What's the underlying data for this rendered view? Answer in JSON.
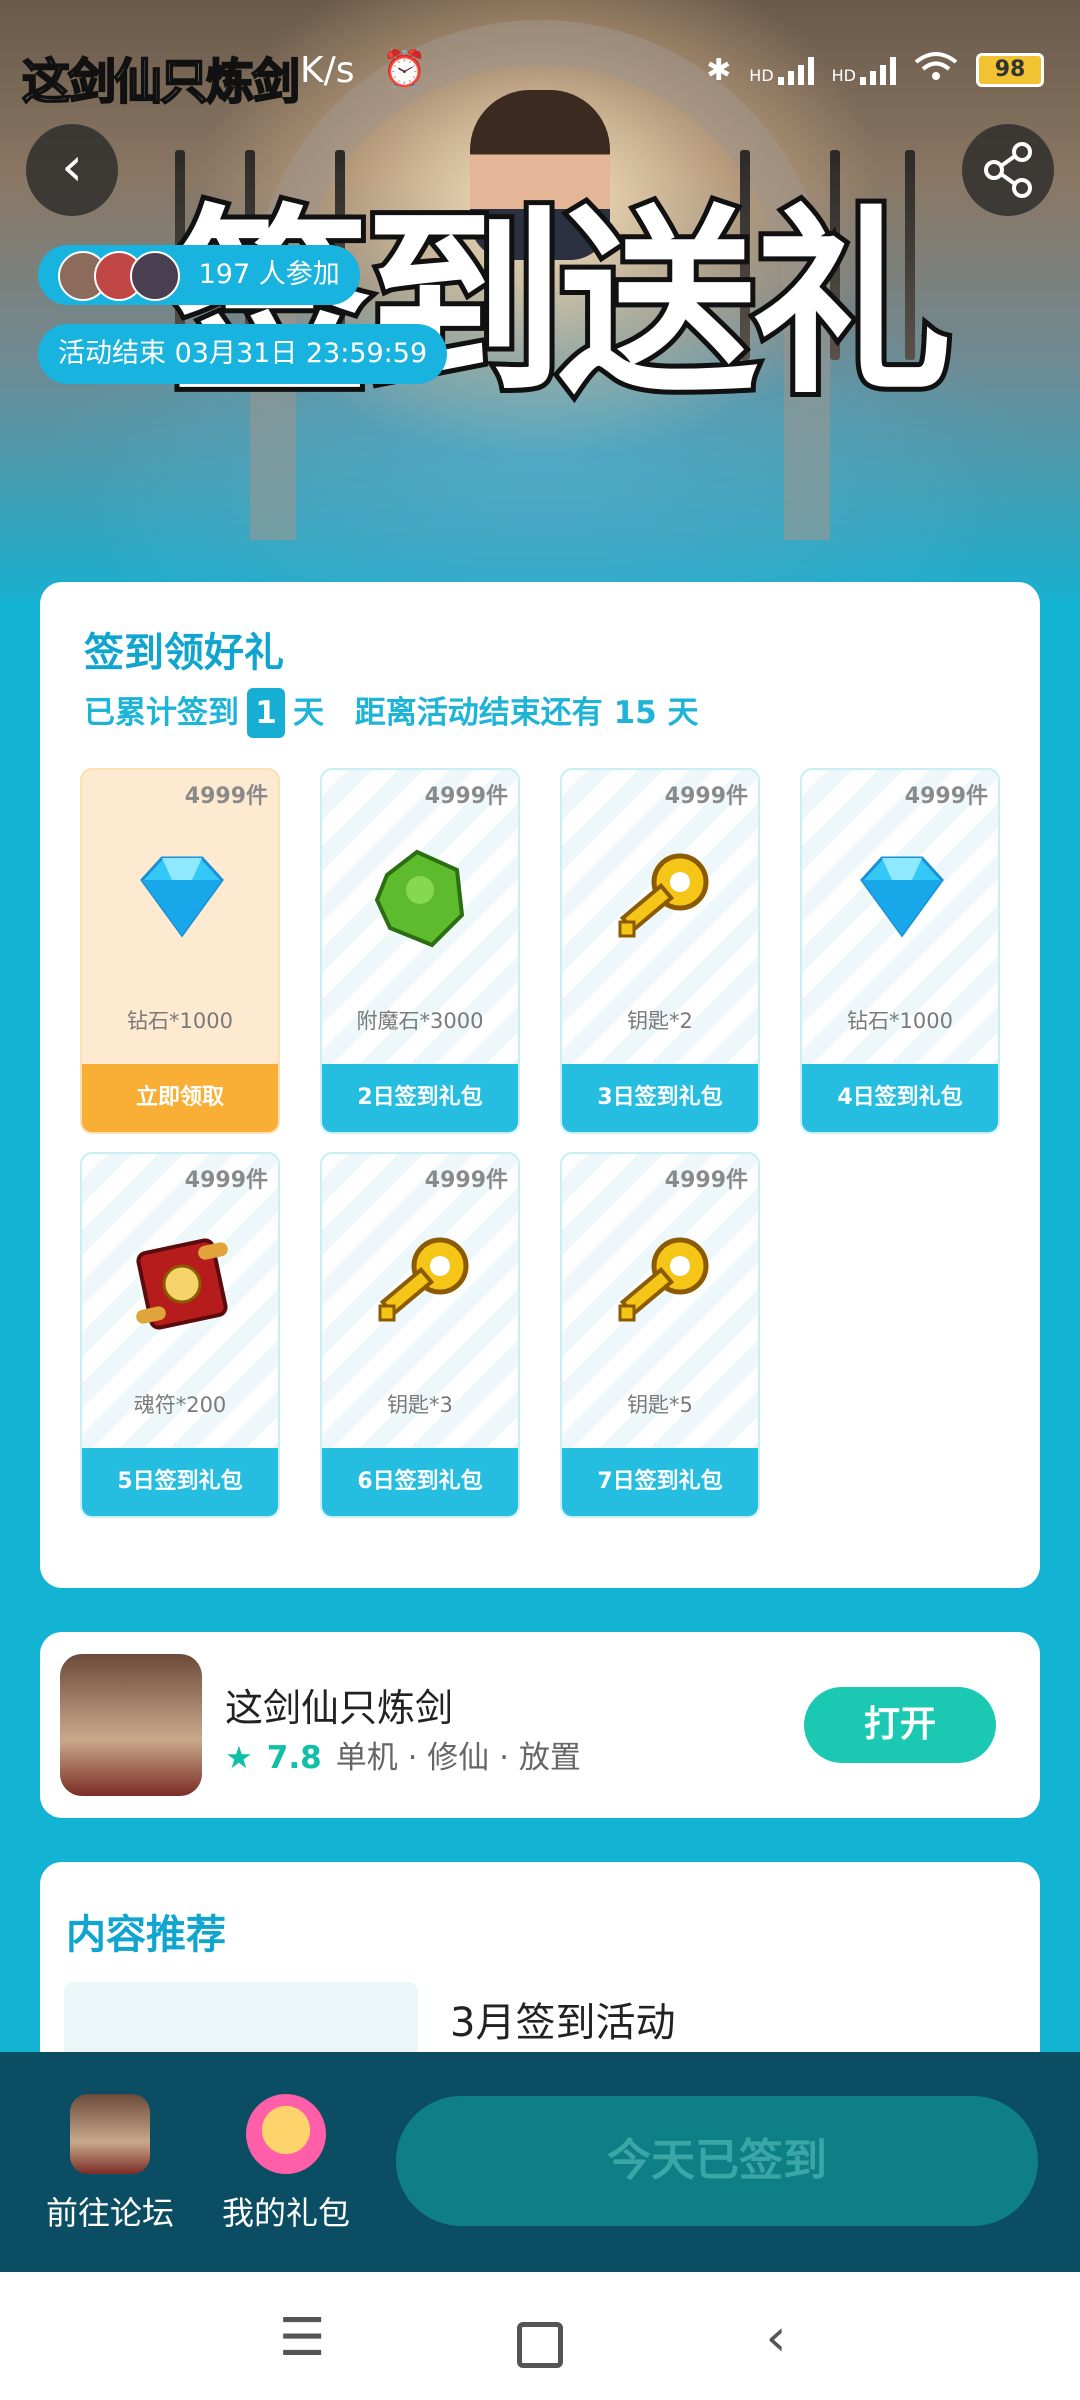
{
  "status_bar": {
    "overlay_title": "这剑仙只炼剑",
    "net_speed": "K/s",
    "network_1": "HD",
    "network_2": "HD",
    "battery": "98"
  },
  "hero": {
    "title": "签到送礼",
    "participants": "197 人参加",
    "end_time": "活动结束 03月31日 23:59:59"
  },
  "signin": {
    "title": "签到领好礼",
    "progress_prefix": "已累计签到",
    "days": "1",
    "progress_suffix": "天",
    "remaining": "距离活动结束还有 15 天",
    "gifts": [
      {
        "stock": "4999件",
        "name": "钻石*1000",
        "button": "立即领取",
        "icon": "diamond-icon"
      },
      {
        "stock": "4999件",
        "name": "附魔石*3000",
        "button": "2日签到礼包",
        "icon": "green-stone-icon"
      },
      {
        "stock": "4999件",
        "name": "钥匙*2",
        "button": "3日签到礼包",
        "icon": "key-icon"
      },
      {
        "stock": "4999件",
        "name": "钻石*1000",
        "button": "4日签到礼包",
        "icon": "diamond-icon"
      },
      {
        "stock": "4999件",
        "name": "魂符*200",
        "button": "5日签到礼包",
        "icon": "scroll-icon"
      },
      {
        "stock": "4999件",
        "name": "钥匙*3",
        "button": "6日签到礼包",
        "icon": "key-icon"
      },
      {
        "stock": "4999件",
        "name": "钥匙*5",
        "button": "7日签到礼包",
        "icon": "key-icon"
      }
    ]
  },
  "app": {
    "name": "这剑仙只炼剑",
    "rating": "7.8",
    "tags": "单机 · 修仙 · 放置",
    "open_label": "打开"
  },
  "recommend": {
    "title": "内容推荐",
    "item_title": "3月签到活动"
  },
  "bottom": {
    "forum_label": "前往论坛",
    "gifts_label": "我的礼包",
    "signed_label": "今天已签到"
  },
  "colors": {
    "accent": "#12b3d3",
    "claim": "#f9ae35",
    "open": "#1bc9b3"
  }
}
